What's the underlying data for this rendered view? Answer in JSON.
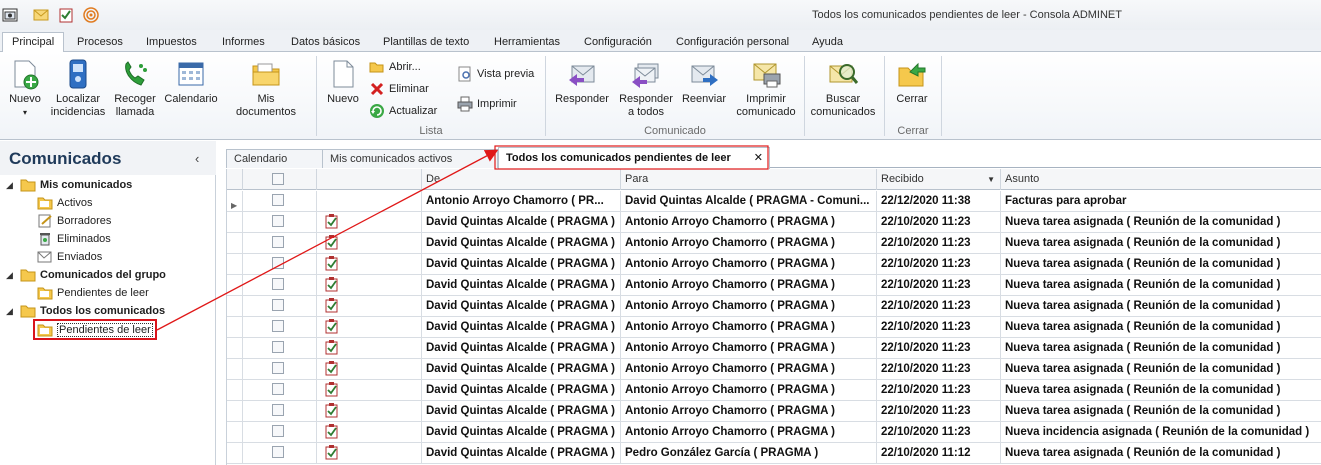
{
  "window": {
    "title": "Todos los comunicados pendientes de leer - Consola ADMINET"
  },
  "ribbon_tabs": [
    "Principal",
    "Procesos",
    "Impuestos",
    "Informes",
    "Datos básicos",
    "Plantillas de texto",
    "Herramientas",
    "Configuración",
    "Configuración personal",
    "Ayuda"
  ],
  "ribbon": {
    "nuevo": "Nuevo",
    "localizar_1": "Localizar",
    "localizar_2": "incidencias",
    "recoger_1": "Recoger",
    "recoger_2": "llamada",
    "calendario": "Calendario",
    "mis_documentos": "Mis documentos",
    "lista_nuevo": "Nuevo",
    "abrir": "Abrir...",
    "eliminar": "Eliminar",
    "actualizar": "Actualizar",
    "vista_previa": "Vista previa",
    "imprimir": "Imprimir",
    "group_lista": "Lista",
    "responder": "Responder",
    "responder_todos_1": "Responder",
    "responder_todos_2": "a todos",
    "reenviar": "Reenviar",
    "imprimir_com_1": "Imprimir",
    "imprimir_com_2": "comunicado",
    "group_comunicado": "Comunicado",
    "buscar_1": "Buscar",
    "buscar_2": "comunicados",
    "cerrar": "Cerrar",
    "group_cerrar": "Cerrar"
  },
  "left_panel": {
    "title": "Comunicados",
    "groups": [
      {
        "label": "Mis comunicados",
        "items": [
          "Activos",
          "Borradores",
          "Eliminados",
          "Enviados"
        ]
      },
      {
        "label": "Comunicados del grupo",
        "items": [
          "Pendientes de leer"
        ]
      },
      {
        "label": "Todos los comunicados",
        "items": [
          "Pendientes de leer"
        ]
      }
    ]
  },
  "doc_tabs": [
    "Calendario",
    "Mis comunicados activos",
    "Todos los comunicados pendientes de leer"
  ],
  "grid": {
    "columns": [
      "De",
      "Para",
      "Recibido",
      "Asunto"
    ],
    "rows": [
      {
        "de": "Antonio Arroyo Chamorro ( PR...",
        "para": "David Quintas Alcalde ( PRAGMA - Comuni...",
        "recibido": "22/12/2020 11:38",
        "asunto": "Facturas para aprobar",
        "icon": false
      },
      {
        "de": "David Quintas Alcalde ( PRAGMA )",
        "para": "Antonio Arroyo Chamorro ( PRAGMA )",
        "recibido": "22/10/2020 11:23",
        "asunto": "Nueva tarea asignada ( Reunión de la comunidad )",
        "icon": true
      },
      {
        "de": "David Quintas Alcalde ( PRAGMA )",
        "para": "Antonio Arroyo Chamorro ( PRAGMA )",
        "recibido": "22/10/2020 11:23",
        "asunto": "Nueva tarea asignada ( Reunión de la comunidad )",
        "icon": true
      },
      {
        "de": "David Quintas Alcalde ( PRAGMA )",
        "para": "Antonio Arroyo Chamorro ( PRAGMA )",
        "recibido": "22/10/2020 11:23",
        "asunto": "Nueva tarea asignada ( Reunión de la comunidad )",
        "icon": true
      },
      {
        "de": "David Quintas Alcalde ( PRAGMA )",
        "para": "Antonio Arroyo Chamorro ( PRAGMA )",
        "recibido": "22/10/2020 11:23",
        "asunto": "Nueva tarea asignada ( Reunión de la comunidad )",
        "icon": true
      },
      {
        "de": "David Quintas Alcalde ( PRAGMA )",
        "para": "Antonio Arroyo Chamorro ( PRAGMA )",
        "recibido": "22/10/2020 11:23",
        "asunto": "Nueva tarea asignada ( Reunión de la comunidad )",
        "icon": true
      },
      {
        "de": "David Quintas Alcalde ( PRAGMA )",
        "para": "Antonio Arroyo Chamorro ( PRAGMA )",
        "recibido": "22/10/2020 11:23",
        "asunto": "Nueva tarea asignada ( Reunión de la comunidad )",
        "icon": true
      },
      {
        "de": "David Quintas Alcalde ( PRAGMA )",
        "para": "Antonio Arroyo Chamorro ( PRAGMA )",
        "recibido": "22/10/2020 11:23",
        "asunto": "Nueva tarea asignada ( Reunión de la comunidad )",
        "icon": true
      },
      {
        "de": "David Quintas Alcalde ( PRAGMA )",
        "para": "Antonio Arroyo Chamorro ( PRAGMA )",
        "recibido": "22/10/2020 11:23",
        "asunto": "Nueva tarea asignada ( Reunión de la comunidad )",
        "icon": true
      },
      {
        "de": "David Quintas Alcalde ( PRAGMA )",
        "para": "Antonio Arroyo Chamorro ( PRAGMA )",
        "recibido": "22/10/2020 11:23",
        "asunto": "Nueva tarea asignada ( Reunión de la comunidad )",
        "icon": true
      },
      {
        "de": "David Quintas Alcalde ( PRAGMA )",
        "para": "Antonio Arroyo Chamorro ( PRAGMA )",
        "recibido": "22/10/2020 11:23",
        "asunto": "Nueva tarea asignada ( Reunión de la comunidad )",
        "icon": true
      },
      {
        "de": "David Quintas Alcalde ( PRAGMA )",
        "para": "Antonio Arroyo Chamorro ( PRAGMA )",
        "recibido": "22/10/2020 11:23",
        "asunto": "Nueva incidencia asignada ( Reunión de la comunidad )",
        "icon": true
      },
      {
        "de": "David Quintas Alcalde ( PRAGMA )",
        "para": "Pedro González García ( PRAGMA )",
        "recibido": "22/10/2020 11:12",
        "asunto": "Nueva tarea asignada ( Reunión de la comunidad )",
        "icon": true
      }
    ]
  },
  "colors": {
    "accent": "#1f3a5a",
    "highlight_box": "#d9141b",
    "tab_border": "#b9c2cd"
  }
}
